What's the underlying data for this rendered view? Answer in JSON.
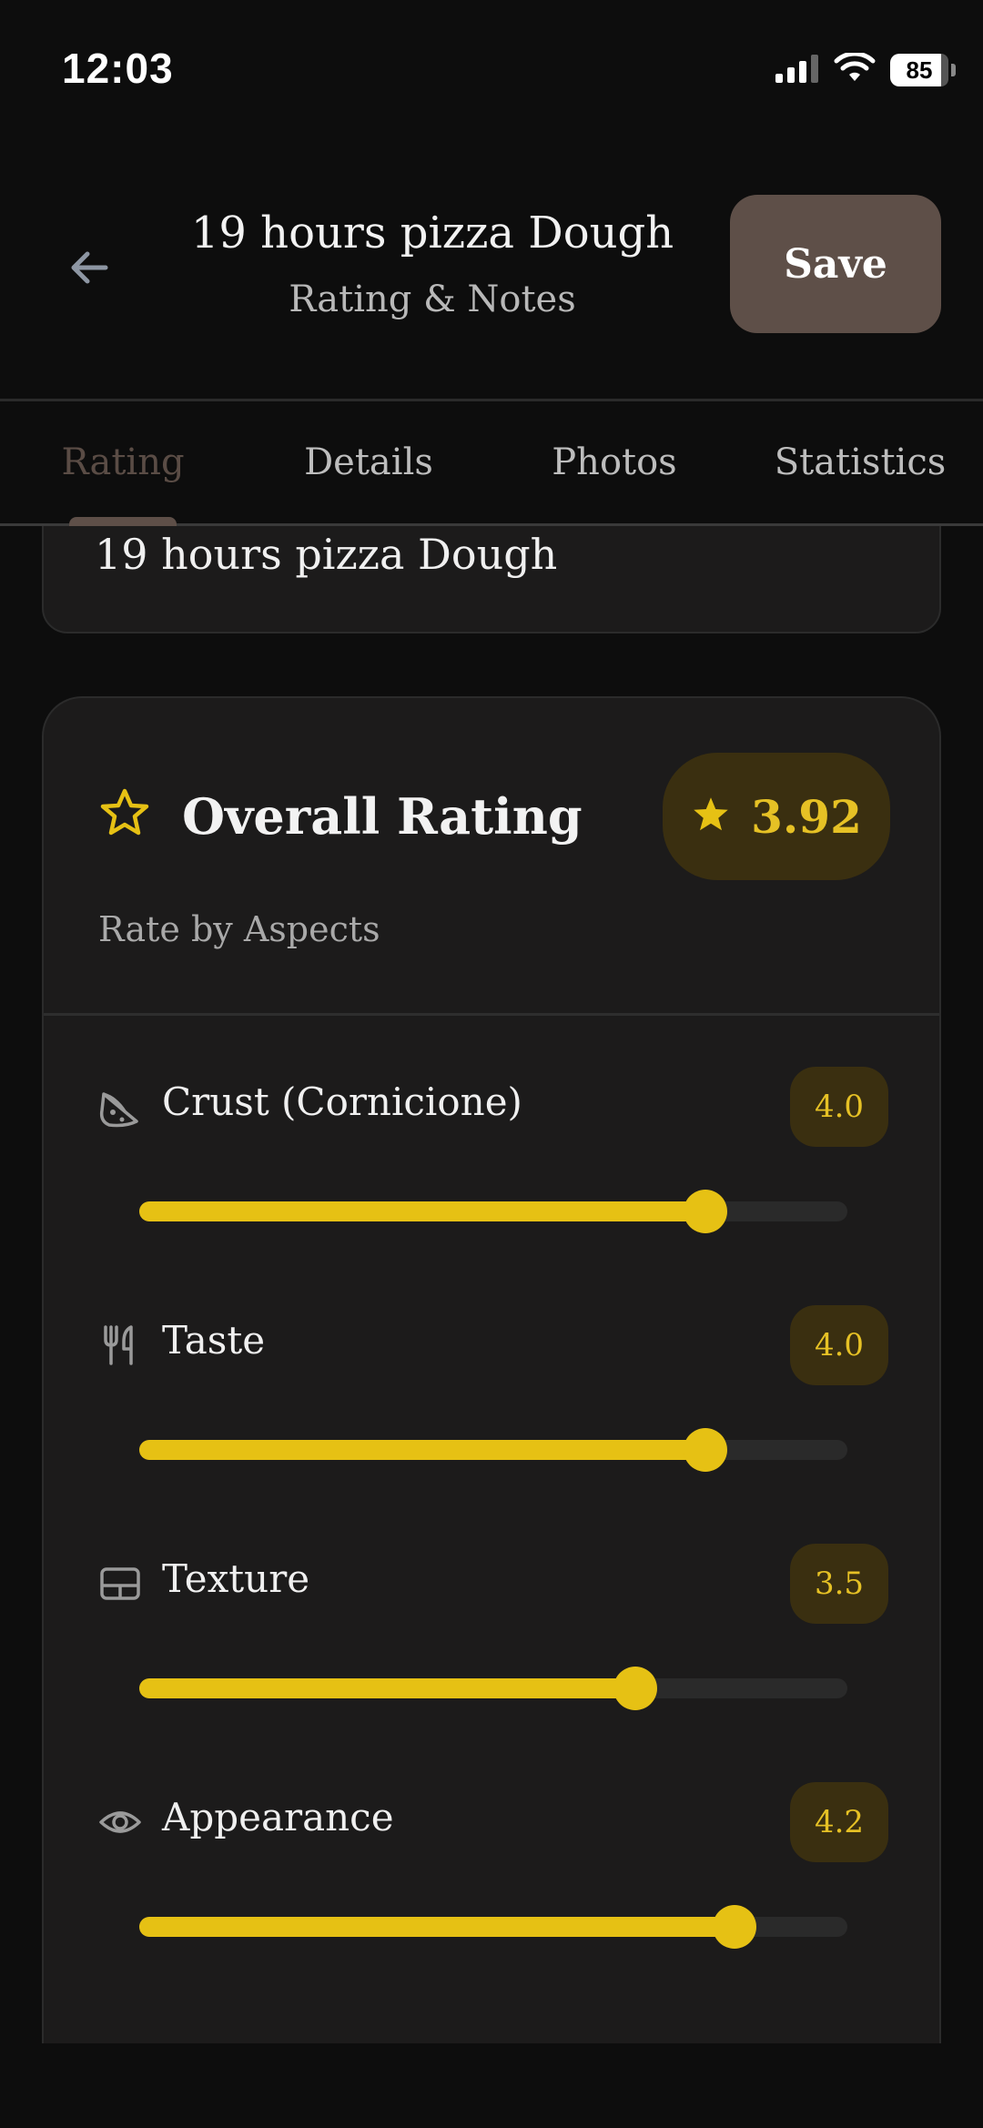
{
  "status": {
    "time": "12:03",
    "battery": "85"
  },
  "header": {
    "title": "19 hours pizza Dough",
    "subtitle": "Rating & Notes",
    "save_label": "Save"
  },
  "tabs": [
    {
      "label": "Rating",
      "active": true
    },
    {
      "label": "Details",
      "active": false
    },
    {
      "label": "Photos",
      "active": false
    },
    {
      "label": "Statistics",
      "active": false
    }
  ],
  "name_card": {
    "name": "19 hours pizza Dough"
  },
  "overall": {
    "title": "Overall Rating",
    "value": "3.92",
    "subtitle": "Rate by Aspects"
  },
  "aspects": [
    {
      "label": "Crust (Cornicione)",
      "value": "4.0",
      "fraction": 0.8,
      "icon": "pizza-slice-icon"
    },
    {
      "label": "Taste",
      "value": "4.0",
      "fraction": 0.8,
      "icon": "utensils-icon"
    },
    {
      "label": "Texture",
      "value": "3.5",
      "fraction": 0.7,
      "icon": "texture-icon"
    },
    {
      "label": "Appearance",
      "value": "4.2",
      "fraction": 0.84,
      "icon": "eye-icon"
    }
  ],
  "colors": {
    "accent": "#e6c114",
    "badge_bg": "#3a2f10",
    "save_bg": "#5e4f48"
  }
}
